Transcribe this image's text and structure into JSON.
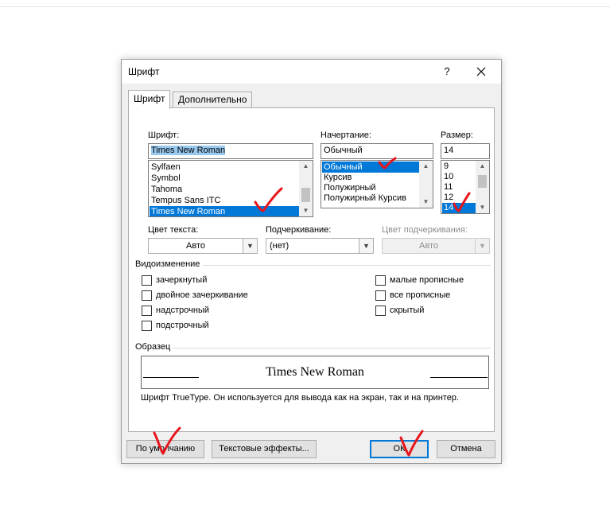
{
  "dialog": {
    "title": "Шрифт",
    "help_label": "?",
    "tabs": [
      {
        "label": "Шрифт",
        "active": true
      },
      {
        "label": "Дополнительно",
        "active": false
      }
    ]
  },
  "font": {
    "label": "Шрифт:",
    "value": "Times New Roman",
    "list": [
      "Sylfaen",
      "Symbol",
      "Tahoma",
      "Tempus Sans ITC",
      "Times New Roman"
    ],
    "selected_index": 4
  },
  "style": {
    "label": "Начертание:",
    "value": "Обычный",
    "list": [
      "Обычный",
      "Курсив",
      "Полужирный",
      "Полужирный Курсив"
    ],
    "selected_index": 0
  },
  "size": {
    "label": "Размер:",
    "value": "14",
    "list": [
      "9",
      "10",
      "11",
      "12",
      "14"
    ],
    "selected_index": 4
  },
  "font_color": {
    "label": "Цвет текста:",
    "value": "Авто"
  },
  "underline": {
    "label": "Подчеркивание:",
    "value": "(нет)"
  },
  "underline_color": {
    "label": "Цвет подчеркивания:",
    "value": "Авто",
    "enabled": false
  },
  "effects": {
    "title": "Видоизменение",
    "left": [
      {
        "label": "зачеркнутый",
        "checked": false
      },
      {
        "label": "двойное зачеркивание",
        "checked": false
      },
      {
        "label": "надстрочный",
        "checked": false
      },
      {
        "label": "подстрочный",
        "checked": false
      }
    ],
    "right": [
      {
        "label": "малые прописные",
        "checked": false
      },
      {
        "label": "все прописные",
        "checked": false
      },
      {
        "label": "скрытый",
        "checked": false
      }
    ]
  },
  "preview": {
    "title": "Образец",
    "text": "Times New Roman",
    "note": "Шрифт TrueType. Он используется для вывода как на экран, так и на принтер."
  },
  "buttons": {
    "default": "По умолчанию",
    "text_effects": "Текстовые эффекты...",
    "ok": "ОК",
    "cancel": "Отмена"
  },
  "colors": {
    "selection": "#0078d7",
    "text_selection": "#99c9ef",
    "annotation": "#e8141b"
  },
  "icons": [
    "close-icon",
    "scroll-up-icon",
    "scroll-down-icon",
    "chevron-down-icon",
    "checkmark-annotation-icon"
  ]
}
